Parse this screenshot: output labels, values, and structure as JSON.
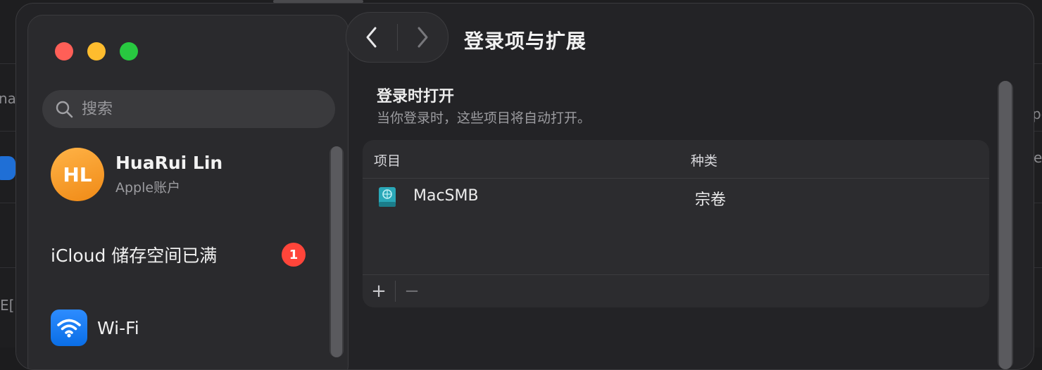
{
  "background_app": {
    "edge_texts": [
      "nal",
      "E[",
      "pe",
      "e"
    ]
  },
  "sidebar": {
    "search": {
      "placeholder": "搜索"
    },
    "account": {
      "initials": "HL",
      "name": "HuaRui Lin",
      "subtitle": "Apple账户"
    },
    "icloud": {
      "label": "iCloud 储存空间已满",
      "badge": "1"
    },
    "wifi": {
      "label": "Wi-Fi"
    }
  },
  "toolbar": {
    "title": "登录项与扩展",
    "back_icon": "chevron-left-icon",
    "forward_icon": "chevron-right-icon"
  },
  "main": {
    "section": {
      "title": "登录时打开",
      "description": "当你登录时，这些项目将自动打开。"
    },
    "table": {
      "columns": [
        "项目",
        "种类"
      ],
      "rows": [
        {
          "name": "MacSMB",
          "kind": "宗卷",
          "icon": "volume-icon"
        }
      ],
      "add_label": "+",
      "remove_label": "−"
    }
  },
  "colors": {
    "close": "#ff5f57",
    "minimize": "#febc2e",
    "zoom": "#28c840",
    "badge": "#ff453a",
    "avatar": "#f59a23",
    "wifi": "#1a7cf2"
  }
}
